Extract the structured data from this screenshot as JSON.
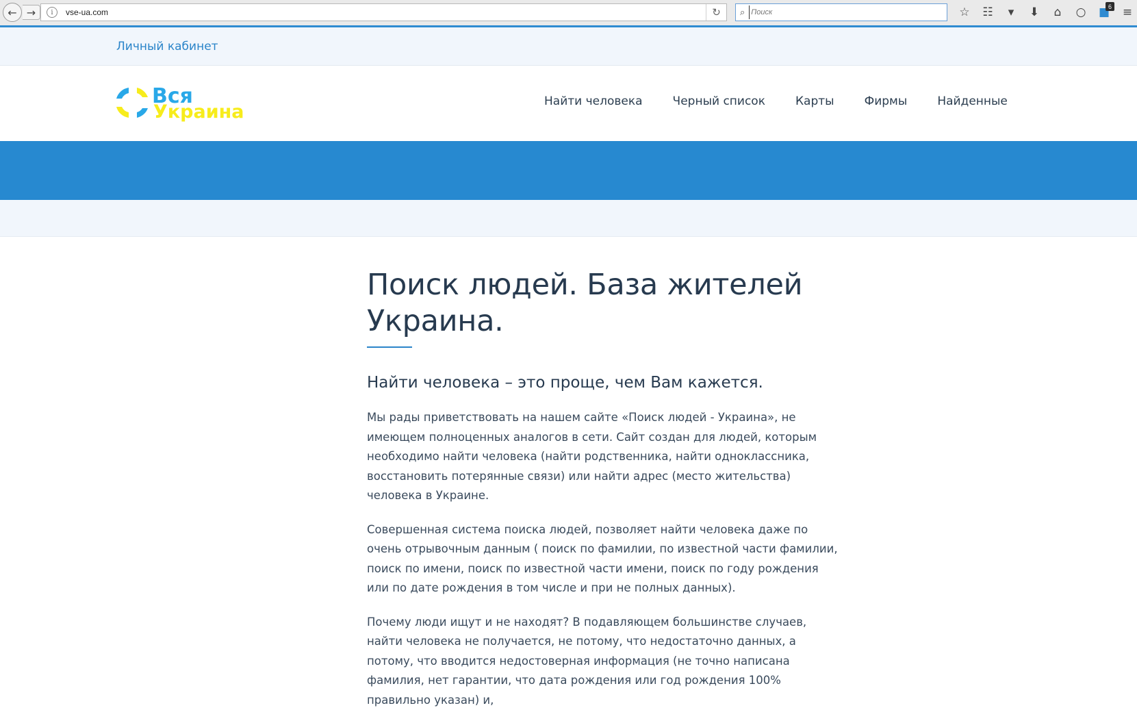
{
  "browser": {
    "url": "vse-ua.com",
    "search_placeholder": "Поиск",
    "badge_count": "6",
    "icons": {
      "back": "arrow-left-icon",
      "forward": "arrow-right-icon",
      "info": "info-icon",
      "reload": "reload-icon",
      "search": "magnifier-icon",
      "bookmark": "star-icon",
      "reader": "clipboard-icon",
      "pocket": "pocket-icon",
      "download": "download-arrow-icon",
      "home": "home-icon",
      "chat": "speech-bubble-icon",
      "account": "account-icon",
      "menu": "hamburger-menu-icon"
    },
    "accent_color": "#2f8bd1"
  },
  "topbar": {
    "cabinet_link": "Личный кабинет"
  },
  "header": {
    "logo_line1": "Вся",
    "logo_line2": "Украина",
    "nav": [
      {
        "label": "Найти человека"
      },
      {
        "label": "Черный список"
      },
      {
        "label": "Карты"
      },
      {
        "label": "Фирмы"
      },
      {
        "label": "Найденные"
      }
    ]
  },
  "colors": {
    "banner": "#2789d0",
    "light_band": "#f1f6fc",
    "link": "#2a84c9",
    "heading": "#273a4f",
    "logo_blue": "#29a8e8",
    "logo_yellow": "#f7ec1c"
  },
  "content": {
    "title": "Поиск людей. База жителей Украина.",
    "subtitle": "Найти человека – это проще, чем Вам кажется.",
    "paragraphs": [
      "Мы рады приветствовать на нашем сайте «Поиск людей - Украина», не имеющем полноценных аналогов в сети. Сайт создан для людей, которым необходимо найти человека (найти родственника, найти одноклассника, восстановить потерянные связи) или найти адрес (место жительства) человека в Украине.",
      "Совершенная система поиска людей, позволяет найти человека даже по очень отрывочным данным ( поиск по фамилии, по известной части фамилии, поиск по имени, поиск по известной части имени,  поиск по году рождения или по дате рождения в том числе и при не полных данных).",
      "Почему люди ищут и не находят? В подавляющем большинстве случаев, найти человека не получается, не потому, что недостаточно данных, а потому, что вводится недостоверная информация (не точно написана фамилия, нет гарантии, что дата рождения или год рождения 100% правильно указан) и,"
    ]
  }
}
